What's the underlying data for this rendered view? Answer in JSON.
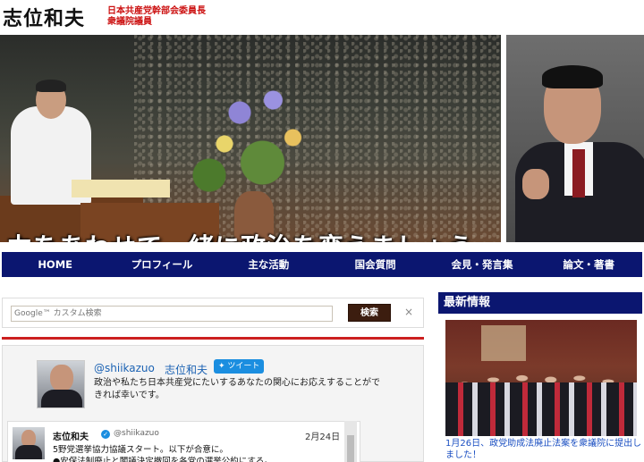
{
  "header": {
    "name": "志位和夫",
    "role_line1": "日本共産党幹部会委員長",
    "role_line2": "衆議院議員"
  },
  "hero": {
    "slogan": "力をあわせて一緒に政治を変えましょう"
  },
  "nav": {
    "items": [
      "HOME",
      "プロフィール",
      "主な活動",
      "国会質問",
      "会見・発言集",
      "論文・著書"
    ]
  },
  "search": {
    "placeholder": "Google™ カスタム検索",
    "button_label": "検索",
    "clear_label": "×"
  },
  "twitter": {
    "handle": "@shiikazuo",
    "name": "志位和夫",
    "tweet_button": "ツイート",
    "description": "政治や私たち日本共産党にたいするあなたの関心にお応えすることができれば幸いです。",
    "tweet": {
      "name": "志位和夫",
      "handle": "@shiikazuo",
      "date": "2月24日",
      "line1": "5野党選挙協力協議スタート。以下が合意に。",
      "line2": "●安保法制廃止と閣議決定撤回を各党の選挙公約にする。"
    }
  },
  "news": {
    "header": "最新情報",
    "caption": "1月26日、政党助成法廃止法案を衆議院に提出しました！"
  },
  "colors": {
    "nav_bg": "#0b1670",
    "accent_red": "#cc1f1f",
    "link_blue": "#1b4fc2"
  }
}
